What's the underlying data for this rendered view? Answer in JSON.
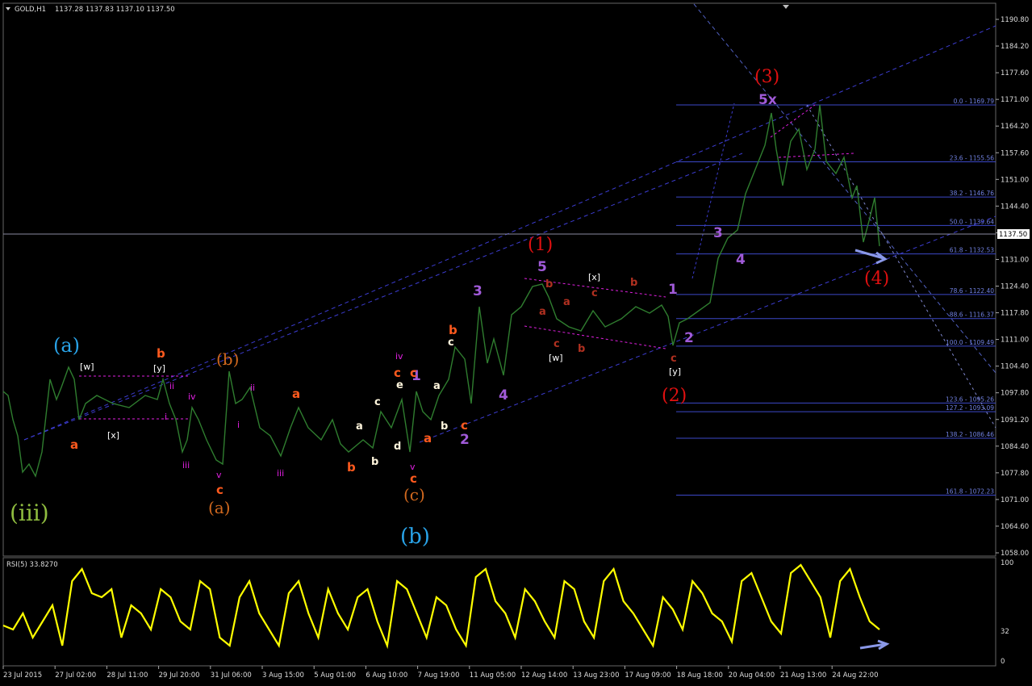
{
  "header": {
    "symbol": "GOLD,H1",
    "ohlc": "1137.28 1137.83 1137.10 1137.50"
  },
  "price_axis": {
    "labels": [
      "1190.80",
      "1184.20",
      "1177.60",
      "1171.00",
      "1164.20",
      "1157.60",
      "1151.00",
      "1144.40",
      "1137.80",
      "1131.00",
      "1124.40",
      "1117.80",
      "1111.00",
      "1104.40",
      "1097.80",
      "1091.20",
      "1084.40",
      "1077.80",
      "1071.00",
      "1064.60",
      "1058.00"
    ],
    "current_price": "1137.50"
  },
  "rsi": {
    "title": "RSI(5) 33.8270",
    "labels": [
      "100",
      "32",
      "0"
    ]
  },
  "time_axis": {
    "labels": [
      "23 Jul 2015",
      "27 Jul 02:00",
      "28 Jul 11:00",
      "29 Jul 20:00",
      "31 Jul 06:00",
      "3 Aug 15:00",
      "5 Aug 01:00",
      "6 Aug 10:00",
      "7 Aug 19:00",
      "11 Aug 05:00",
      "12 Aug 14:00",
      "13 Aug 23:00",
      "17 Aug 09:00",
      "18 Aug 18:00",
      "20 Aug 04:00",
      "21 Aug 13:00",
      "24 Aug 22:00"
    ]
  },
  "fib": {
    "levels": [
      {
        "label": "0.0 - 1169.79",
        "price": 1169.79
      },
      {
        "label": "23.6 - 1155.56",
        "price": 1155.56
      },
      {
        "label": "38.2 - 1146.76",
        "price": 1146.76
      },
      {
        "label": "50.0 - 1139.64",
        "price": 1139.64
      },
      {
        "label": "61.8 - 1132.53",
        "price": 1132.53
      },
      {
        "label": "78.6 - 1122.40",
        "price": 1122.4
      },
      {
        "label": "88.6 - 1116.37",
        "price": 1116.37
      },
      {
        "label": "100.0 - 1109.49",
        "price": 1109.49
      },
      {
        "label": "123.6 - 1095.26",
        "price": 1095.26
      },
      {
        "label": "127.2 - 1093.09",
        "price": 1093.09
      },
      {
        "label": "138.2 - 1086.46",
        "price": 1086.46
      },
      {
        "label": "161.8 - 1072.23",
        "price": 1072.23
      }
    ]
  },
  "colors": {
    "price_line": "#2f7d2f",
    "rsi_line": "#ffff00",
    "channel": "#3c3cd0",
    "fib": "#3c48c8",
    "magenta": "#e020e0"
  },
  "annotations": [
    {
      "text": "(iii)",
      "color": "#8fbc3f"
    },
    {
      "text": "(a)",
      "color": "#29a3e8"
    },
    {
      "text": "(b)",
      "color": "#29a3e8"
    },
    {
      "text": "(b)",
      "color": "#d2691e"
    },
    {
      "text": "(a)",
      "color": "#d2691e"
    },
    {
      "text": "(c)",
      "color": "#d2691e"
    },
    {
      "text": "(1)",
      "color": "#e01010"
    },
    {
      "text": "(2)",
      "color": "#e01010"
    },
    {
      "text": "(3)",
      "color": "#e01010"
    },
    {
      "text": "(4)",
      "color": "#e01010"
    },
    {
      "text": "5x",
      "color": "#a05ad8"
    },
    {
      "text": "1",
      "color": "#a05ad8"
    },
    {
      "text": "2",
      "color": "#a05ad8"
    },
    {
      "text": "3",
      "color": "#a05ad8"
    },
    {
      "text": "4",
      "color": "#a05ad8"
    },
    {
      "text": "5",
      "color": "#a05ad8"
    },
    {
      "text": "1",
      "color": "#a05ad8"
    },
    {
      "text": "2",
      "color": "#a05ad8"
    },
    {
      "text": "3",
      "color": "#a05ad8"
    },
    {
      "text": "4",
      "color": "#a05ad8"
    },
    {
      "text": "[w]",
      "color": "#ffffff"
    },
    {
      "text": "[x]",
      "color": "#ffffff"
    },
    {
      "text": "[y]",
      "color": "#ffffff"
    },
    {
      "text": "[w]",
      "color": "#ffffff"
    },
    {
      "text": "[x]",
      "color": "#ffffff"
    },
    {
      "text": "[y]",
      "color": "#ffffff"
    },
    {
      "text": "a",
      "color": "#ff5a1e"
    },
    {
      "text": "b",
      "color": "#ff5a1e"
    },
    {
      "text": "c",
      "color": "#ff5a1e"
    },
    {
      "text": "a",
      "color": "#ff5a1e"
    },
    {
      "text": "b",
      "color": "#ff5a1e"
    },
    {
      "text": "c",
      "color": "#ff5a1e"
    },
    {
      "text": "c",
      "color": "#ff5a1e"
    },
    {
      "text": "a",
      "color": "#ff5a1e"
    },
    {
      "text": "b",
      "color": "#ff5a1e"
    },
    {
      "text": "c",
      "color": "#ff5a1e"
    },
    {
      "text": "c",
      "color": "#ff5a1e"
    },
    {
      "text": "i",
      "color": "#e020e0"
    },
    {
      "text": "ii",
      "color": "#e020e0"
    },
    {
      "text": "iii",
      "color": "#e020e0"
    },
    {
      "text": "iv",
      "color": "#e020e0"
    },
    {
      "text": "v",
      "color": "#e020e0"
    },
    {
      "text": "i",
      "color": "#e020e0"
    },
    {
      "text": "ii",
      "color": "#e020e0"
    },
    {
      "text": "iii",
      "color": "#e020e0"
    },
    {
      "text": "iv",
      "color": "#e020e0"
    },
    {
      "text": "v",
      "color": "#e020e0"
    },
    {
      "text": "a",
      "color": "#fff5dc"
    },
    {
      "text": "b",
      "color": "#fff5dc"
    },
    {
      "text": "c",
      "color": "#fff5dc"
    },
    {
      "text": "d",
      "color": "#fff5dc"
    },
    {
      "text": "e",
      "color": "#fff5dc"
    },
    {
      "text": "a",
      "color": "#fff5dc"
    },
    {
      "text": "b",
      "color": "#fff5dc"
    },
    {
      "text": "c",
      "color": "#fff5dc"
    },
    {
      "text": "a",
      "color": "#b03020"
    },
    {
      "text": "b",
      "color": "#b03020"
    },
    {
      "text": "c",
      "color": "#b03020"
    },
    {
      "text": "a",
      "color": "#b03020"
    },
    {
      "text": "b",
      "color": "#b03020"
    },
    {
      "text": "c",
      "color": "#b03020"
    },
    {
      "text": "b",
      "color": "#b03020"
    },
    {
      "text": "c",
      "color": "#b03020"
    }
  ]
}
